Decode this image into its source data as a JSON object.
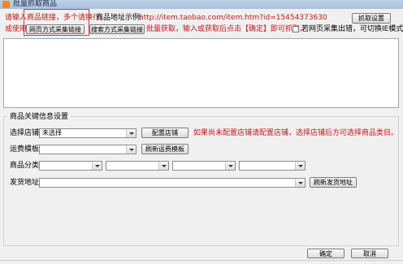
{
  "window": {
    "title": "批量抓取商品"
  },
  "row1": {
    "instruction": "请输入商品链接，多个请换行。",
    "example_label": "商品地址示例:",
    "example_url": "http://item.taobao.com/item.htm?id=15454373630",
    "fetch_settings_label": "抓取设置"
  },
  "row2": {
    "or_use": "或使用",
    "web_collect_label": "网页方式采集链接",
    "search_collect_label": "搜索方式采集链接",
    "hint": "批量获取，输入或获取后点击【确定】即可抓取。",
    "checkbox_label": "若网页采集出错，可切换IE模式",
    "checkbox_checked": false
  },
  "link_input": {
    "value": ""
  },
  "settings": {
    "group_title": "商品关键信息设置",
    "store_label": "选择店铺",
    "store_value": "未选择",
    "config_store_label": "配置店铺",
    "store_hint": "如果尚未配置店铺请配置店铺，选择店铺后方可选择商品类目。",
    "shipping_label": "运费模板",
    "shipping_value": "",
    "refresh_shipping_label": "刷新运费模板",
    "category_label": "商品分类",
    "categories": [
      "",
      "",
      "",
      ""
    ],
    "address_label": "发货地址",
    "address_value": "",
    "refresh_address_label": "刷新发货地址"
  },
  "footer": {
    "ok_label": "确定",
    "cancel_label": "取消"
  },
  "colors": {
    "accent_red": "#c8161e",
    "title_bar": "#a9c1df"
  }
}
